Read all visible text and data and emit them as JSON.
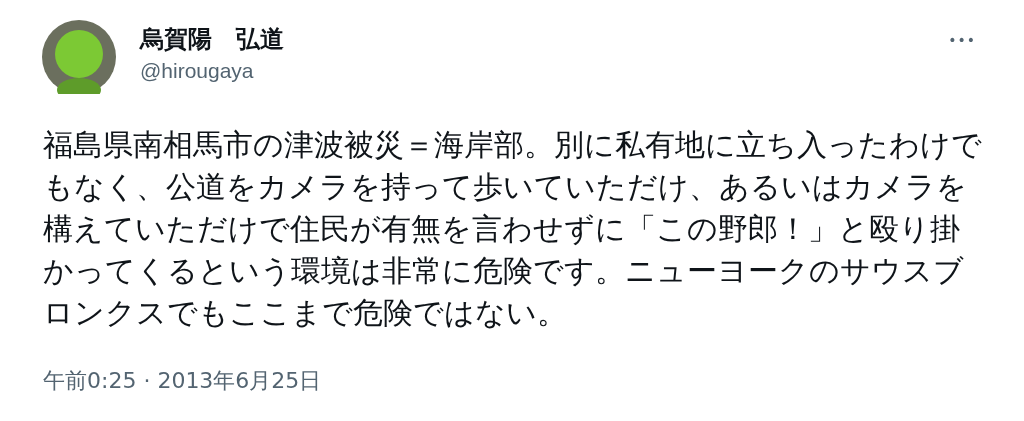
{
  "author": {
    "name": "烏賀陽　弘道",
    "handle": "@hirougaya"
  },
  "more_button": "•••",
  "text": "福島県南相馬市の津波被災＝海岸部。別に私有地に立ち入ったわけでもなく、公道をカメラを持って歩いていただけ、あるいはカメラを構えていただけで住民が有無を言わせずに「この野郎！」と殴り掛かってくるという環境は非常に危険です。ニューヨークのサウスブロンクスでもここまで危険ではない。",
  "timestamp": "午前0:25 · 2013年6月25日"
}
